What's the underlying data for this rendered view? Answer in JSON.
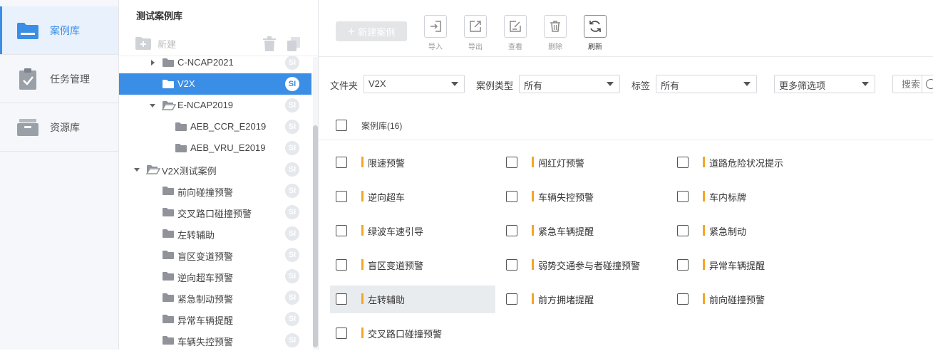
{
  "nav": {
    "items": [
      {
        "label": "案例库",
        "icon": "folder-icon",
        "active": true
      },
      {
        "label": "任务管理",
        "icon": "clipboard-check-icon",
        "active": false
      },
      {
        "label": "资源库",
        "icon": "archive-box-icon",
        "active": false
      }
    ]
  },
  "tree": {
    "title": "测试案例库",
    "new_label": "新建",
    "rows": [
      {
        "name": "C-NCAP2021",
        "level": 1,
        "expand": "collapsed",
        "open": false,
        "selected": false,
        "badge": "SI",
        "folderColor": "#909399"
      },
      {
        "name": "V2X",
        "level": 1,
        "expand": "none",
        "open": false,
        "selected": true,
        "badge": "SI",
        "folderColor": "#ffffff"
      },
      {
        "name": "E-NCAP2019",
        "level": 1,
        "expand": "expanded",
        "open": true,
        "selected": false,
        "badge": "SI",
        "folderColor": "#909399"
      },
      {
        "name": "AEB_CCR_E2019",
        "level": 2,
        "expand": "none",
        "open": false,
        "selected": false,
        "badge": "SI",
        "folderColor": "#909399"
      },
      {
        "name": "AEB_VRU_E2019",
        "level": 2,
        "expand": "none",
        "open": false,
        "selected": false,
        "badge": "SI",
        "folderColor": "#909399"
      },
      {
        "name": "V2X测试案例",
        "level": 0,
        "expand": "expanded",
        "open": true,
        "selected": false,
        "badge": "SI",
        "folderColor": "#909399"
      },
      {
        "name": "前向碰撞预警",
        "level": 1,
        "expand": "none",
        "open": false,
        "selected": false,
        "badge": "SI",
        "folderColor": "#909399"
      },
      {
        "name": "交叉路口碰撞预警",
        "level": 1,
        "expand": "none",
        "open": false,
        "selected": false,
        "badge": "SI",
        "folderColor": "#909399"
      },
      {
        "name": "左转辅助",
        "level": 1,
        "expand": "none",
        "open": false,
        "selected": false,
        "badge": "SI",
        "folderColor": "#909399"
      },
      {
        "name": "盲区变道预警",
        "level": 1,
        "expand": "none",
        "open": false,
        "selected": false,
        "badge": "SI",
        "folderColor": "#909399"
      },
      {
        "name": "逆向超车预警",
        "level": 1,
        "expand": "none",
        "open": false,
        "selected": false,
        "badge": "SI",
        "folderColor": "#909399"
      },
      {
        "name": "紧急制动预警",
        "level": 1,
        "expand": "none",
        "open": false,
        "selected": false,
        "badge": "SI",
        "folderColor": "#909399"
      },
      {
        "name": "异常车辆提醒",
        "level": 1,
        "expand": "none",
        "open": false,
        "selected": false,
        "badge": "SI",
        "folderColor": "#909399"
      },
      {
        "name": "车辆失控预警",
        "level": 1,
        "expand": "none",
        "open": false,
        "selected": false,
        "badge": "SI",
        "folderColor": "#909399"
      }
    ]
  },
  "toolbar": {
    "new_case_label": "新建案例",
    "buttons": [
      {
        "label": "导入",
        "icon": "import-icon",
        "active": false
      },
      {
        "label": "导出",
        "icon": "export-icon",
        "active": false
      },
      {
        "label": "查看",
        "icon": "view-edit-icon",
        "active": false
      },
      {
        "label": "删除",
        "icon": "trash-icon",
        "active": false
      },
      {
        "label": "刷新",
        "icon": "refresh-icon",
        "active": true
      }
    ]
  },
  "filters": {
    "folder_label": "文件夹",
    "folder_value": "V2X",
    "type_label": "案例类型",
    "type_value": "所有",
    "tag_label": "标签",
    "tag_value": "所有",
    "more_value": "更多筛选项",
    "search_placeholder": "搜索"
  },
  "list": {
    "header": "案例库(16)",
    "cases": [
      {
        "name": "限速预警",
        "col": 0,
        "row": 0,
        "hover": false
      },
      {
        "name": "闯红灯预警",
        "col": 1,
        "row": 0,
        "hover": false
      },
      {
        "name": "道路危险状况提示",
        "col": 2,
        "row": 0,
        "hover": false
      },
      {
        "name": "逆向超车",
        "col": 0,
        "row": 1,
        "hover": false
      },
      {
        "name": "车辆失控预警",
        "col": 1,
        "row": 1,
        "hover": false
      },
      {
        "name": "车内标牌",
        "col": 2,
        "row": 1,
        "hover": false
      },
      {
        "name": "绿波车速引导",
        "col": 0,
        "row": 2,
        "hover": false
      },
      {
        "name": "紧急车辆提醒",
        "col": 1,
        "row": 2,
        "hover": false
      },
      {
        "name": "紧急制动",
        "col": 2,
        "row": 2,
        "hover": false
      },
      {
        "name": "盲区变道预警",
        "col": 0,
        "row": 3,
        "hover": false
      },
      {
        "name": "弱势交通参与者碰撞预警",
        "col": 1,
        "row": 3,
        "hover": false
      },
      {
        "name": "异常车辆提醒",
        "col": 2,
        "row": 3,
        "hover": false
      },
      {
        "name": "左转辅助",
        "col": 0,
        "row": 4,
        "hover": true
      },
      {
        "name": "前方拥堵提醒",
        "col": 1,
        "row": 4,
        "hover": false
      },
      {
        "name": "前向碰撞预警",
        "col": 2,
        "row": 4,
        "hover": false
      },
      {
        "name": "交叉路口碰撞预警",
        "col": 0,
        "row": 5,
        "hover": false
      }
    ]
  }
}
